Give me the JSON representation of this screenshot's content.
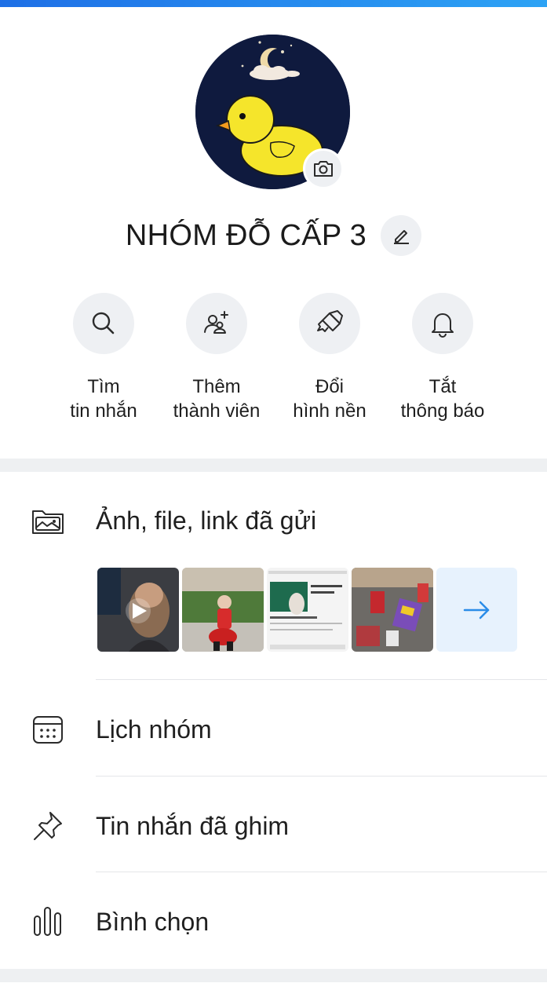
{
  "group": {
    "name": "NHÓM ĐỖ CẤP 3"
  },
  "actions": [
    {
      "line1": "Tìm",
      "line2": "tin nhắn",
      "icon": "search-icon"
    },
    {
      "line1": "Thêm",
      "line2": "thành viên",
      "icon": "add-member-icon"
    },
    {
      "line1": "Đổi",
      "line2": "hình nền",
      "icon": "paintbrush-icon"
    },
    {
      "line1": "Tắt",
      "line2": "thông báo",
      "icon": "bell-icon"
    }
  ],
  "menu": {
    "media": {
      "label": "Ảnh, file, link đã gửi",
      "icon": "gallery-folder-icon"
    },
    "calendar": {
      "label": "Lịch nhóm",
      "icon": "calendar-icon"
    },
    "pinned": {
      "label": "Tin nhắn đã ghim",
      "icon": "pin-icon"
    },
    "poll": {
      "label": "Bình chọn",
      "icon": "poll-icon"
    }
  },
  "colors": {
    "accent": "#1e6fe6",
    "icon_grey": "#2b2b2b",
    "bg_chip": "#eef0f3",
    "arrow_blue": "#2a8ce8"
  }
}
